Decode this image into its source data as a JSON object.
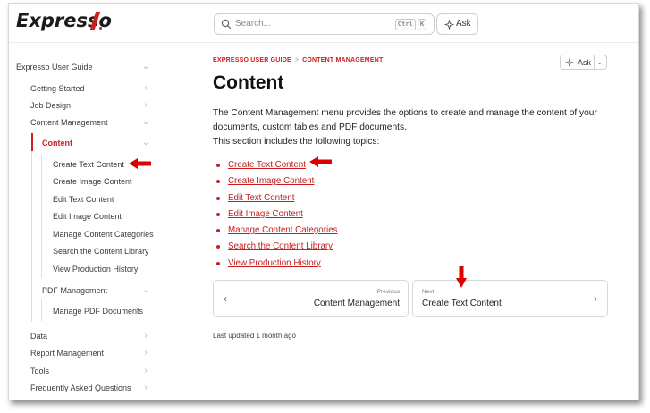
{
  "header": {
    "logo_text": "Expresso",
    "search_placeholder": "Search...",
    "shortcut_key1": "Ctrl",
    "shortcut_key2": "K",
    "ask_label": "Ask"
  },
  "sidebar": {
    "root": "Expresso User Guide",
    "items": [
      {
        "label": "Getting Started"
      },
      {
        "label": "Job Design"
      },
      {
        "label": "Content Management"
      },
      {
        "label": "Content"
      },
      {
        "label": "Create Text Content"
      },
      {
        "label": "Create Image Content"
      },
      {
        "label": "Edit Text Content"
      },
      {
        "label": "Edit Image Content"
      },
      {
        "label": "Manage Content Categories"
      },
      {
        "label": "Search the Content Library"
      },
      {
        "label": "View Production History"
      },
      {
        "label": "PDF Management"
      },
      {
        "label": "Manage PDF Documents"
      },
      {
        "label": "Data"
      },
      {
        "label": "Report Management"
      },
      {
        "label": "Tools"
      },
      {
        "label": "Frequently Asked Questions"
      }
    ]
  },
  "main": {
    "breadcrumb": [
      "EXPRESSO USER GUIDE",
      "CONTENT MANAGEMENT"
    ],
    "breadcrumb_sep": ">",
    "ask_label": "Ask",
    "title": "Content",
    "intro_line1": "The Content Management menu provides the options to create and manage the content of your documents, custom tables and PDF documents.",
    "intro_line2": "This section includes the following topics:",
    "topics": [
      "Create Text Content",
      "Create Image Content",
      "Edit Text Content",
      "Edit Image Content",
      "Manage Content Categories",
      "Search the Content Library",
      "View Production History"
    ],
    "pager": {
      "prev_small": "Previous",
      "prev_title": "Content Management",
      "next_small": "Next",
      "next_title": "Create Text Content"
    },
    "last_updated": "Last updated 1 month ago"
  },
  "colors": {
    "accent": "#cc1f1f",
    "link": "#c41e1e",
    "annotation_arrow": "#dd0000"
  }
}
